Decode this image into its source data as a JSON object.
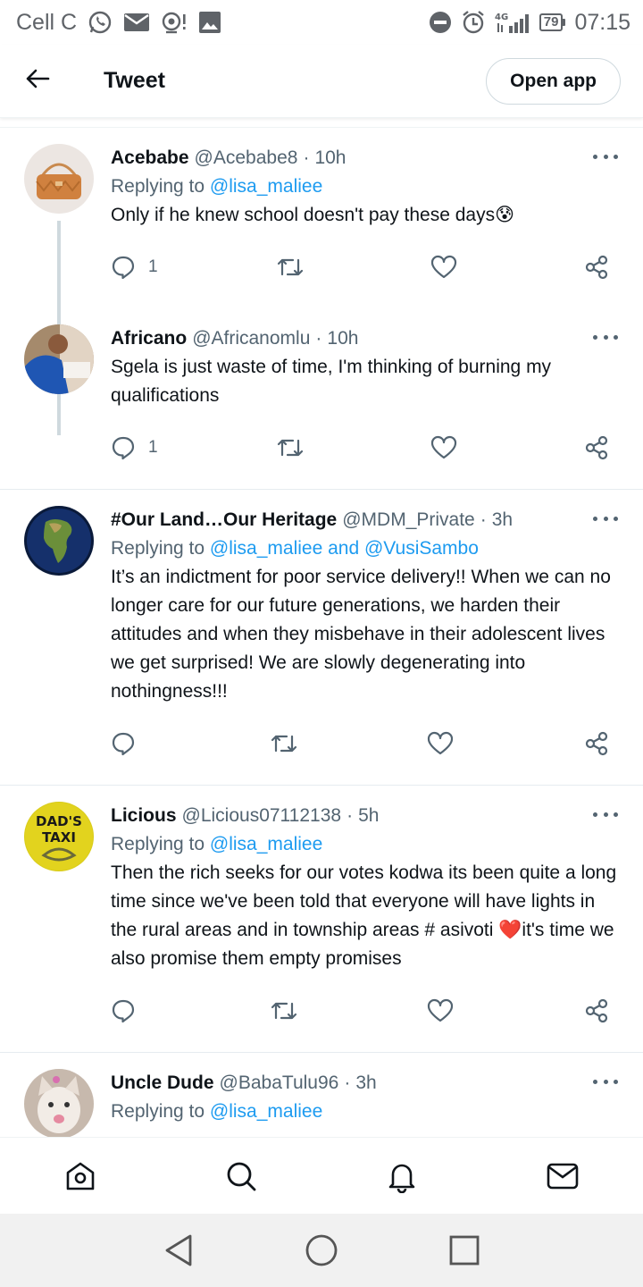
{
  "status_bar": {
    "carrier": "Cell C",
    "network": "4G",
    "battery": "79",
    "time": "07:15"
  },
  "header": {
    "title": "Tweet",
    "open_app_label": "Open app"
  },
  "tweets": [
    {
      "name": "Acebabe",
      "handle": "@Acebabe8",
      "time": "10h",
      "reply_prefix": "Replying to ",
      "reply_to": "@lisa_maliee",
      "text": "Only if he knew school doesn't pay these days😰",
      "reply_count": "1",
      "avatar": "handbag"
    },
    {
      "name": "Africano",
      "handle": "@Africanomlu",
      "time": "10h",
      "text": "Sgela is just waste of time, I'm thinking of burning my qualifications",
      "reply_count": "1",
      "avatar": "person"
    },
    {
      "name": "#Our Land…Our Heritage",
      "handle": "@MDM_Private",
      "time": "3h",
      "reply_prefix": "Replying to ",
      "reply_to": "@lisa_maliee and @VusiSambo",
      "text": "It’s an indictment for poor service delivery!! When we can no longer care for our future generations, we harden their attitudes and when they misbehave in their adolescent lives we get surprised! We are slowly degenerating into nothingness!!!",
      "reply_count": "",
      "avatar": "globe"
    },
    {
      "name": "Licious",
      "handle": "@Licious07112138",
      "time": "5h",
      "reply_prefix": "Replying to ",
      "reply_to": "@lisa_maliee",
      "text_before": "Then the rich seeks for our votes kodwa its been quite a long time since we've been told that everyone will have lights in the rural areas and in township areas # asivoti ",
      "heart_emoji": "❤️",
      "text_after": "it's time we also promise them empty promises",
      "reply_count": "",
      "avatar_text_line1": "DAD'S",
      "avatar_text_line2": "TAXI"
    },
    {
      "name": "Uncle Dude",
      "handle": "@BabaTulu96",
      "time": "3h",
      "reply_prefix": "Replying to ",
      "reply_to": "@lisa_maliee",
      "avatar": "cat"
    }
  ],
  "colors": {
    "accent": "#1d9bf0",
    "text": "#0f1419",
    "secondary": "#536471",
    "border": "#eff3f4"
  },
  "bottom_nav": [
    "home-icon",
    "search-icon",
    "notifications-icon",
    "messages-icon"
  ],
  "system_nav": [
    "back-triangle-icon",
    "home-circle-icon",
    "recents-square-icon"
  ]
}
